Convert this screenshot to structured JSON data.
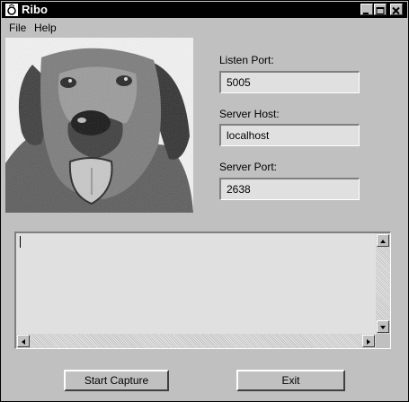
{
  "window": {
    "title": "Ribo"
  },
  "menu": {
    "file": "File",
    "help": "Help"
  },
  "form": {
    "listen_port": {
      "label": "Listen Port:",
      "value": "5005"
    },
    "server_host": {
      "label": "Server Host:",
      "value": "localhost"
    },
    "server_port": {
      "label": "Server Port:",
      "value": "2638"
    }
  },
  "log": {
    "text": ""
  },
  "buttons": {
    "start": "Start Capture",
    "exit": "Exit"
  },
  "icons": [
    "app-icon",
    "minimize-icon",
    "maximize-icon",
    "close-icon",
    "arrow-up-icon",
    "arrow-down-icon",
    "arrow-left-icon",
    "arrow-right-icon"
  ],
  "colors": {
    "titlebar": "#000000",
    "background": "#c0c0c0",
    "field": "#e0e0e0"
  }
}
